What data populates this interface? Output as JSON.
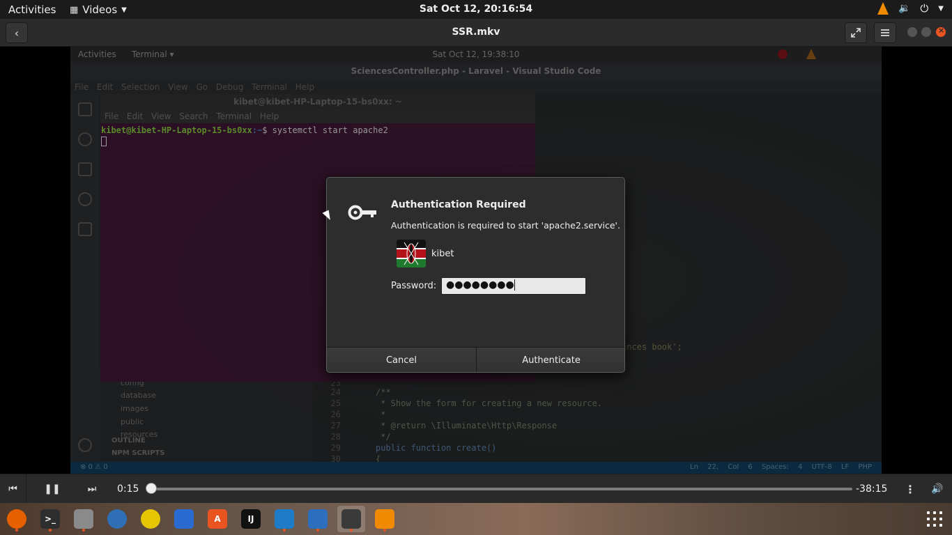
{
  "topbar": {
    "activities": "Activities",
    "app_name": "Videos",
    "clock": "Sat Oct 12, 20:16:54",
    "tray_icons": [
      "vlc-icon",
      "volume-icon",
      "power-icon",
      "chevron-down-icon"
    ]
  },
  "player": {
    "title": "SSR.mkv",
    "back_icon": "back-arrow-icon",
    "fullscreen_icon": "fullscreen-icon",
    "menu_icon": "hamburger-menu-icon",
    "current_time": "0:15",
    "remaining_time": "-38:15",
    "progress_fraction": 0.0065
  },
  "recording": {
    "activities": "Activities",
    "app": "Terminal ▾",
    "clock": "Sat Oct 12, 19:38:10",
    "vscode_title": "SciencesController.php - Laravel - Visual Studio Code",
    "vscode_menu": [
      "File",
      "Edit",
      "Selection",
      "View",
      "Go",
      "Debug",
      "Terminal",
      "Help"
    ],
    "terminal_title": "kibet@kibet-HP-Laptop-15-bs0xx: ~",
    "terminal_menu": [
      "File",
      "Edit",
      "View",
      "Search",
      "Terminal",
      "Help"
    ],
    "prompt_user": "kibet@kibet-HP-Laptop-15-bs0xx",
    "prompt_path": ":~",
    "command": "$ systemctl start apache2",
    "explorer_items": [
      "config",
      "database",
      "images",
      "public",
      "resources"
    ],
    "outline": "OUTLINE",
    "npm_scripts": "NPM SCRIPTS",
    "code_fragment": "ences book';",
    "code_lines": [
      {
        "n": "23",
        "t": ""
      },
      {
        "n": "24",
        "t": "/**"
      },
      {
        "n": "25",
        "t": " * Show the form for creating a new resource."
      },
      {
        "n": "26",
        "t": " *"
      },
      {
        "n": "27",
        "t": " * @return \\Illuminate\\Http\\Response"
      },
      {
        "n": "28",
        "t": " */"
      },
      {
        "n": "29",
        "t": "public function create()"
      },
      {
        "n": "30",
        "t": "{"
      }
    ],
    "status_left": "⊗ 0 ⚠ 0",
    "status_right": "Ln 22, Col 6   Spaces: 4   UTF-8   LF   PHP"
  },
  "auth_dialog": {
    "title": "Authentication Required",
    "message": "Authentication is required to start 'apache2.service'.",
    "user": "kibet",
    "password_label": "Password:",
    "password_value": "●●●●●●●●",
    "cancel_label": "Cancel",
    "authenticate_label": "Authenticate"
  },
  "dock": {
    "apps": [
      {
        "name": "firefox-icon",
        "label": "",
        "color": "#e66000",
        "running": true
      },
      {
        "name": "terminal-icon",
        "label": ">_",
        "color": "#2e2e2e",
        "running": true
      },
      {
        "name": "files-icon",
        "label": "",
        "color": "#8a8a8a",
        "running": true
      },
      {
        "name": "thunderbird-icon",
        "label": "",
        "color": "#2f6fb5",
        "running": false
      },
      {
        "name": "rhythmbox-icon",
        "label": "",
        "color": "#e5c600",
        "running": false
      },
      {
        "name": "writer-icon",
        "label": "",
        "color": "#2a6bd1",
        "running": false
      },
      {
        "name": "software-center-icon",
        "label": "A",
        "color": "#e95420",
        "running": false
      },
      {
        "name": "intellij-icon",
        "label": "IJ",
        "color": "#111111",
        "running": false
      },
      {
        "name": "vscode-icon",
        "label": "",
        "color": "#1e7bc7",
        "running": true
      },
      {
        "name": "remmina-icon",
        "label": "",
        "color": "#2b6fbd",
        "running": true
      },
      {
        "name": "videos-icon",
        "label": "",
        "color": "#3a3a3a",
        "running": true
      },
      {
        "name": "vlc-icon",
        "label": "",
        "color": "#f08a00",
        "running": true
      }
    ],
    "show_apps_icon": "show-applications-icon"
  },
  "colors": {
    "accent": "#e95420",
    "dialog_bg": "#2d2d2d",
    "terminal_bg": "#2c0f24"
  }
}
